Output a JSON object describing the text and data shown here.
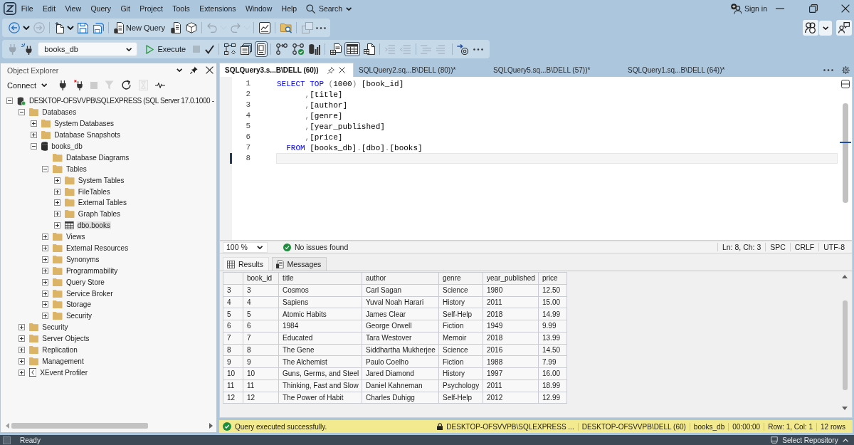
{
  "title_bar": {
    "menu": [
      "File",
      "Edit",
      "View",
      "Query",
      "Git",
      "Project",
      "Tools",
      "Extensions",
      "Window",
      "Help"
    ],
    "search": "Search",
    "sign_in": "Sign in"
  },
  "toolbar_standard": {
    "buttons": [
      {
        "disabled": false
      },
      {
        "disabled": false
      },
      {
        "disabled": true
      },
      {
        "disabled": false
      },
      {
        "disabled": false
      },
      {
        "disabled": false
      },
      {
        "disabled": false
      },
      {
        "label": "New Query",
        "disabled": false
      },
      {
        "disabled": false
      },
      {
        "disabled": false
      },
      {
        "disabled": true
      },
      {
        "disabled": true
      },
      {
        "disabled": true
      },
      {
        "disabled": true
      },
      {
        "disabled": false
      },
      {
        "disabled": false
      },
      {
        "disabled": true
      },
      {
        "disabled": false
      }
    ]
  },
  "toolbar_sql": {
    "connect_buttons": [
      {
        "disabled": true
      },
      {
        "disabled": false
      }
    ],
    "database": "books_db",
    "execute": {
      "label": "Execute",
      "disabled": false
    },
    "buttons": [
      {
        "disabled": true,
        "pressed": false
      },
      {
        "disabled": false,
        "pressed": false
      },
      {
        "disabled": false,
        "pressed": false
      },
      {
        "disabled": false,
        "pressed": false
      },
      {
        "disabled": false,
        "pressed": true
      },
      {
        "disabled": false,
        "pressed": false
      },
      {
        "disabled": false,
        "pressed": false
      },
      {
        "disabled": false,
        "pressed": false
      },
      {
        "disabled": false,
        "pressed": false
      },
      {
        "disabled": false,
        "pressed": true
      },
      {
        "disabled": false,
        "pressed": false
      },
      {
        "disabled": true,
        "pressed": false
      },
      {
        "disabled": true,
        "pressed": false
      },
      {
        "disabled": true,
        "pressed": false
      },
      {
        "disabled": true,
        "pressed": false
      },
      {
        "disabled": false,
        "pressed": false
      },
      {
        "disabled": false,
        "pressed": false
      }
    ]
  },
  "object_explorer": {
    "title": "Object Explorer",
    "connect": "Connect",
    "toolbar": [
      {
        "disabled": false
      },
      {
        "disabled": false
      },
      {
        "disabled": true
      },
      {
        "disabled": true
      },
      {
        "disabled": false
      },
      {
        "disabled": true
      },
      {
        "disabled": false
      }
    ],
    "tree": [
      {
        "label": "DESKTOP-OFSVVPB\\SQLEXPRESS (SQL Server 17.0.1000 -",
        "kind": "server",
        "expanded": true,
        "selected": false,
        "children": [
          {
            "label": "Databases",
            "kind": "folder",
            "expanded": true,
            "selected": false,
            "children": [
              {
                "label": "System Databases",
                "kind": "folder",
                "expanded": false,
                "selected": false
              },
              {
                "label": "Database Snapshots",
                "kind": "folder",
                "expanded": false,
                "selected": false
              },
              {
                "label": "books_db",
                "kind": "database",
                "expanded": true,
                "selected": false,
                "children": [
                  {
                    "label": "Database Diagrams",
                    "kind": "folder",
                    "selected": false
                  },
                  {
                    "label": "Tables",
                    "kind": "folder",
                    "expanded": true,
                    "selected": false,
                    "children": [
                      {
                        "label": "System Tables",
                        "kind": "folder",
                        "expanded": false,
                        "selected": false
                      },
                      {
                        "label": "FileTables",
                        "kind": "folder",
                        "expanded": false,
                        "selected": false
                      },
                      {
                        "label": "External Tables",
                        "kind": "folder",
                        "expanded": false,
                        "selected": false
                      },
                      {
                        "label": "Graph Tables",
                        "kind": "folder",
                        "expanded": false,
                        "selected": false
                      },
                      {
                        "label": "dbo.books",
                        "kind": "table",
                        "expanded": false,
                        "selected": true
                      }
                    ]
                  },
                  {
                    "label": "Views",
                    "kind": "folder",
                    "expanded": false,
                    "selected": false
                  },
                  {
                    "label": "External Resources",
                    "kind": "folder",
                    "expanded": false,
                    "selected": false
                  },
                  {
                    "label": "Synonyms",
                    "kind": "folder",
                    "expanded": false,
                    "selected": false
                  },
                  {
                    "label": "Programmability",
                    "kind": "folder",
                    "expanded": false,
                    "selected": false
                  },
                  {
                    "label": "Query Store",
                    "kind": "folder",
                    "expanded": false,
                    "selected": false
                  },
                  {
                    "label": "Service Broker",
                    "kind": "folder",
                    "expanded": false,
                    "selected": false
                  },
                  {
                    "label": "Storage",
                    "kind": "folder",
                    "expanded": false,
                    "selected": false
                  },
                  {
                    "label": "Security",
                    "kind": "folder",
                    "expanded": false,
                    "selected": false
                  }
                ]
              }
            ]
          },
          {
            "label": "Security",
            "kind": "folder",
            "expanded": false,
            "selected": false
          },
          {
            "label": "Server Objects",
            "kind": "folder",
            "expanded": false,
            "selected": false
          },
          {
            "label": "Replication",
            "kind": "folder",
            "expanded": false,
            "selected": false
          },
          {
            "label": "Management",
            "kind": "folder",
            "expanded": false,
            "selected": false
          },
          {
            "label": "XEvent Profiler",
            "kind": "profiler",
            "expanded": false,
            "selected": false
          }
        ]
      }
    ]
  },
  "editor": {
    "tabs": [
      {
        "label": "SQLQuery3.s...B\\DELL (60))",
        "selected": true
      },
      {
        "label": "SQLQuery2.sq...B\\DELL (80))*",
        "selected": false
      },
      {
        "label": "SQLQuery5.sq...B\\DELL (57))*",
        "selected": false
      },
      {
        "label": "SQLQuery1.sq...B\\DELL (64))*",
        "selected": false
      }
    ],
    "lines": [
      {
        "number": "1",
        "current": false,
        "tokens": [
          {
            "text": "SELECT TOP",
            "kind": "keyword"
          },
          {
            "text": " (",
            "kind": "punct"
          },
          {
            "text": "1000",
            "kind": "plain"
          },
          {
            "text": ")",
            "kind": "punct"
          },
          {
            "text": " [book_id]",
            "kind": "plain"
          }
        ]
      },
      {
        "number": "2",
        "current": false,
        "tokens": [
          {
            "text": "      ,",
            "kind": "punct"
          },
          {
            "text": "[title]",
            "kind": "plain"
          }
        ]
      },
      {
        "number": "3",
        "current": false,
        "tokens": [
          {
            "text": "      ,",
            "kind": "punct"
          },
          {
            "text": "[author]",
            "kind": "plain"
          }
        ]
      },
      {
        "number": "4",
        "current": false,
        "tokens": [
          {
            "text": "      ,",
            "kind": "punct"
          },
          {
            "text": "[genre]",
            "kind": "plain"
          }
        ]
      },
      {
        "number": "5",
        "current": false,
        "tokens": [
          {
            "text": "      ,",
            "kind": "punct"
          },
          {
            "text": "[year_published]",
            "kind": "plain"
          }
        ]
      },
      {
        "number": "6",
        "current": false,
        "tokens": [
          {
            "text": "      ,",
            "kind": "punct"
          },
          {
            "text": "[price]",
            "kind": "plain"
          }
        ]
      },
      {
        "number": "7",
        "current": false,
        "tokens": [
          {
            "text": "  FROM",
            "kind": "keyword"
          },
          {
            "text": " [books_db]",
            "kind": "plain"
          },
          {
            "text": ".",
            "kind": "punct"
          },
          {
            "text": "[dbo]",
            "kind": "plain"
          },
          {
            "text": ".",
            "kind": "punct"
          },
          {
            "text": "[books]",
            "kind": "plain"
          }
        ]
      },
      {
        "number": "8",
        "current": true
      }
    ],
    "zoom": "100 %",
    "issues": "No issues found",
    "cursor_info": [
      "Ln: 8, Ch: 3",
      "SPC",
      "CRLF",
      "UTF-8"
    ]
  },
  "results": {
    "tabs": [
      {
        "label": "Results",
        "selected": true
      },
      {
        "label": "Messages",
        "selected": false
      }
    ],
    "columns": [
      "book_id",
      "title",
      "author",
      "genre",
      "year_published",
      "price"
    ],
    "rows": [
      {
        "number": "3",
        "cells": [
          "3",
          "Cosmos",
          "Carl Sagan",
          "Science",
          "1980",
          "12.50"
        ]
      },
      {
        "number": "4",
        "cells": [
          "4",
          "Sapiens",
          "Yuval Noah Harari",
          "History",
          "2011",
          "15.00"
        ]
      },
      {
        "number": "5",
        "cells": [
          "5",
          "Atomic Habits",
          "James Clear",
          "Self-Help",
          "2018",
          "14.99"
        ]
      },
      {
        "number": "6",
        "cells": [
          "6",
          "1984",
          "George Orwell",
          "Fiction",
          "1949",
          "9.99"
        ]
      },
      {
        "number": "7",
        "cells": [
          "7",
          "Educated",
          "Tara Westover",
          "Memoir",
          "2018",
          "13.99"
        ]
      },
      {
        "number": "8",
        "cells": [
          "8",
          "The Gene",
          "Siddhartha Mukherjee",
          "Science",
          "2016",
          "14.50"
        ]
      },
      {
        "number": "9",
        "cells": [
          "9",
          "The Alchemist",
          "Paulo Coelho",
          "Fiction",
          "1988",
          "7.99"
        ]
      },
      {
        "number": "10",
        "cells": [
          "10",
          "Guns, Germs, and Steel",
          "Jared Diamond",
          "History",
          "1997",
          "16.00"
        ]
      },
      {
        "number": "11",
        "cells": [
          "11",
          "Thinking, Fast and Slow",
          "Daniel Kahneman",
          "Psychology",
          "2011",
          "18.99"
        ]
      },
      {
        "number": "12",
        "cells": [
          "12",
          "The Power of Habit",
          "Charles Duhigg",
          "Self-Help",
          "2012",
          "12.99"
        ]
      }
    ]
  },
  "query_status": {
    "message": "Query executed successfully.",
    "server": "DESKTOP-OFSVVPB\\SQLEXPRESS ...",
    "login": "DESKTOP-OFSVVPB\\DELL (60)",
    "database": "books_db",
    "elapsed": "00:00:00",
    "position": "Row: 1, Col: 1",
    "row_count": "12 rows"
  },
  "status_bar": {
    "text": "Ready",
    "repository": "Select Repository"
  }
}
